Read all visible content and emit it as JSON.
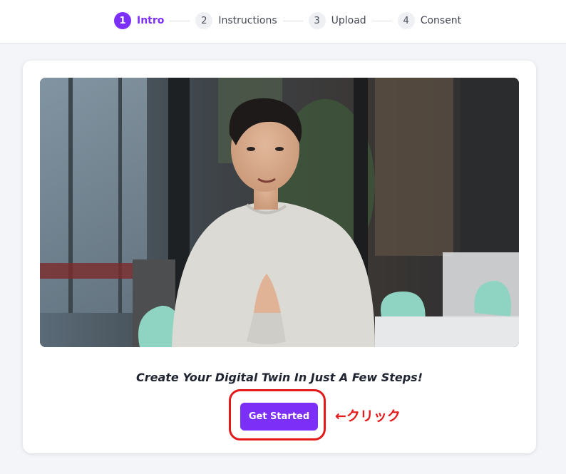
{
  "stepper": {
    "steps": [
      {
        "number": "1",
        "label": "Intro",
        "active": true
      },
      {
        "number": "2",
        "label": "Instructions",
        "active": false
      },
      {
        "number": "3",
        "label": "Upload",
        "active": false
      },
      {
        "number": "4",
        "label": "Consent",
        "active": false
      }
    ]
  },
  "main": {
    "headline": "Create Your Digital Twin In Just A Few Steps!",
    "cta_label": "Get Started"
  },
  "annotation": {
    "text": "←クリック"
  },
  "colors": {
    "accent": "#7b2ff7",
    "annotation_red": "#e41a1a",
    "page_background": "#f4f5f8"
  }
}
